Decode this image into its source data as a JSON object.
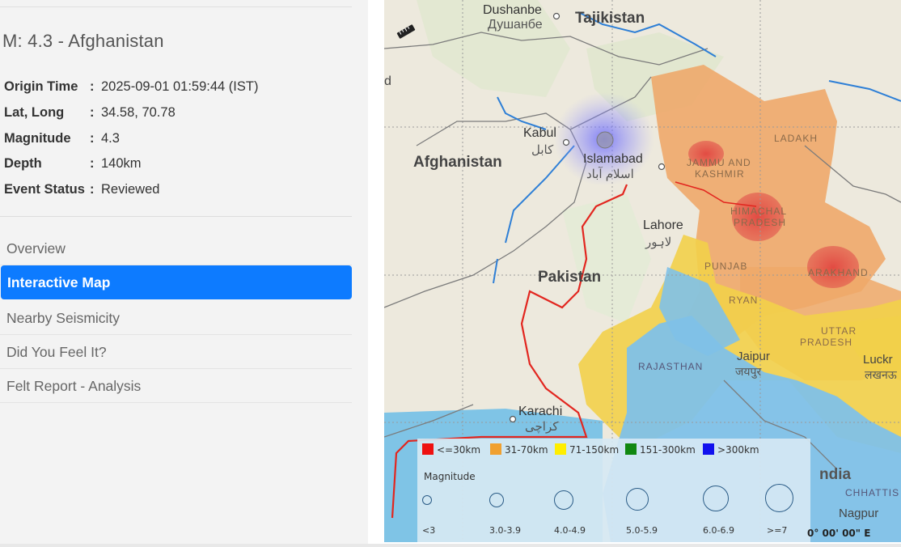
{
  "event": {
    "title": "M: 4.3 - Afghanistan",
    "details": [
      {
        "label": "Origin Time",
        "sep": ":",
        "value": "2025-09-01 01:59:44 (IST)"
      },
      {
        "label": "Lat, Long",
        "sep": ":",
        "value": "34.58, 70.78"
      },
      {
        "label": "Magnitude",
        "sep": ":",
        "value": "4.3"
      },
      {
        "label": "Depth",
        "sep": ":",
        "value": "140km"
      },
      {
        "label": "Event Status",
        "sep": ":",
        "value": "Reviewed"
      }
    ]
  },
  "nav": {
    "items": [
      {
        "label": "Overview",
        "active": false
      },
      {
        "label": "Interactive Map",
        "active": true
      },
      {
        "label": "Nearby Seismicity",
        "active": false
      },
      {
        "label": "Did You Feel It?",
        "active": false
      },
      {
        "label": "Felt Report - Analysis",
        "active": false
      }
    ]
  },
  "map": {
    "labels": {
      "dushanbe": "Dushanbe",
      "dushanbe_local": "Душанбе",
      "tajikistan": "Tajikistan",
      "kabul": "Kabul",
      "kabul_local": "کابل",
      "afghanistan": "Afghanistan",
      "islamabad": "Islamabad",
      "islamabad_local": "اسلام آباد",
      "lahore": "Lahore",
      "lahore_local": "لاہور",
      "pakistan": "Pakistan",
      "karachi": "Karachi",
      "karachi_local": "کراچی",
      "ladakh": "LADAKH",
      "jammu1": "JAMMU AND",
      "jammu2": "KASHMIR",
      "himachal1": "HIMACHAL",
      "himachal2": "PRADESH",
      "punjab": "PUNJAB",
      "haryana": "RYAN",
      "uttarakhand": "ARAKHAND",
      "uttar1": "UTTAR",
      "uttar2": "PRADESH",
      "rajasthan": "RAJASTHAN",
      "jaipur": "Jaipur",
      "jaipur_local": "जयपुर",
      "lucknow": "Luckr",
      "lucknow_local": "लखनऊ",
      "india": "ndia",
      "chhattis": "CHHATTIS",
      "nagpur": "Nagpur",
      "left_partial": "d"
    },
    "coordinate_readout": "0° 00' 00\" E",
    "legend": {
      "depth": [
        {
          "label": "<=30km",
          "color": "#ee1111"
        },
        {
          "label": "31-70km",
          "color": "#f0a030"
        },
        {
          "label": "71-150km",
          "color": "#ffee00"
        },
        {
          "label": "151-300km",
          "color": "#118811"
        },
        {
          "label": ">300km",
          "color": "#1111ee"
        }
      ],
      "magnitude_title": "Magnitude",
      "magnitude": [
        {
          "label": "<3"
        },
        {
          "label": "3.0-3.9"
        },
        {
          "label": "4.0-4.9"
        },
        {
          "label": "5.0-5.9"
        },
        {
          "label": "6.0-6.9"
        },
        {
          "label": ">=7"
        }
      ]
    },
    "colors": {
      "orange_zone": "#eea96a",
      "yellow_zone": "#f2d04a",
      "blue_zone": "#7fc1e8",
      "red_hotspot": "#e04848",
      "border": "#e2261f",
      "river": "#2e7fd6",
      "event_glow": "#6a6aff"
    }
  }
}
